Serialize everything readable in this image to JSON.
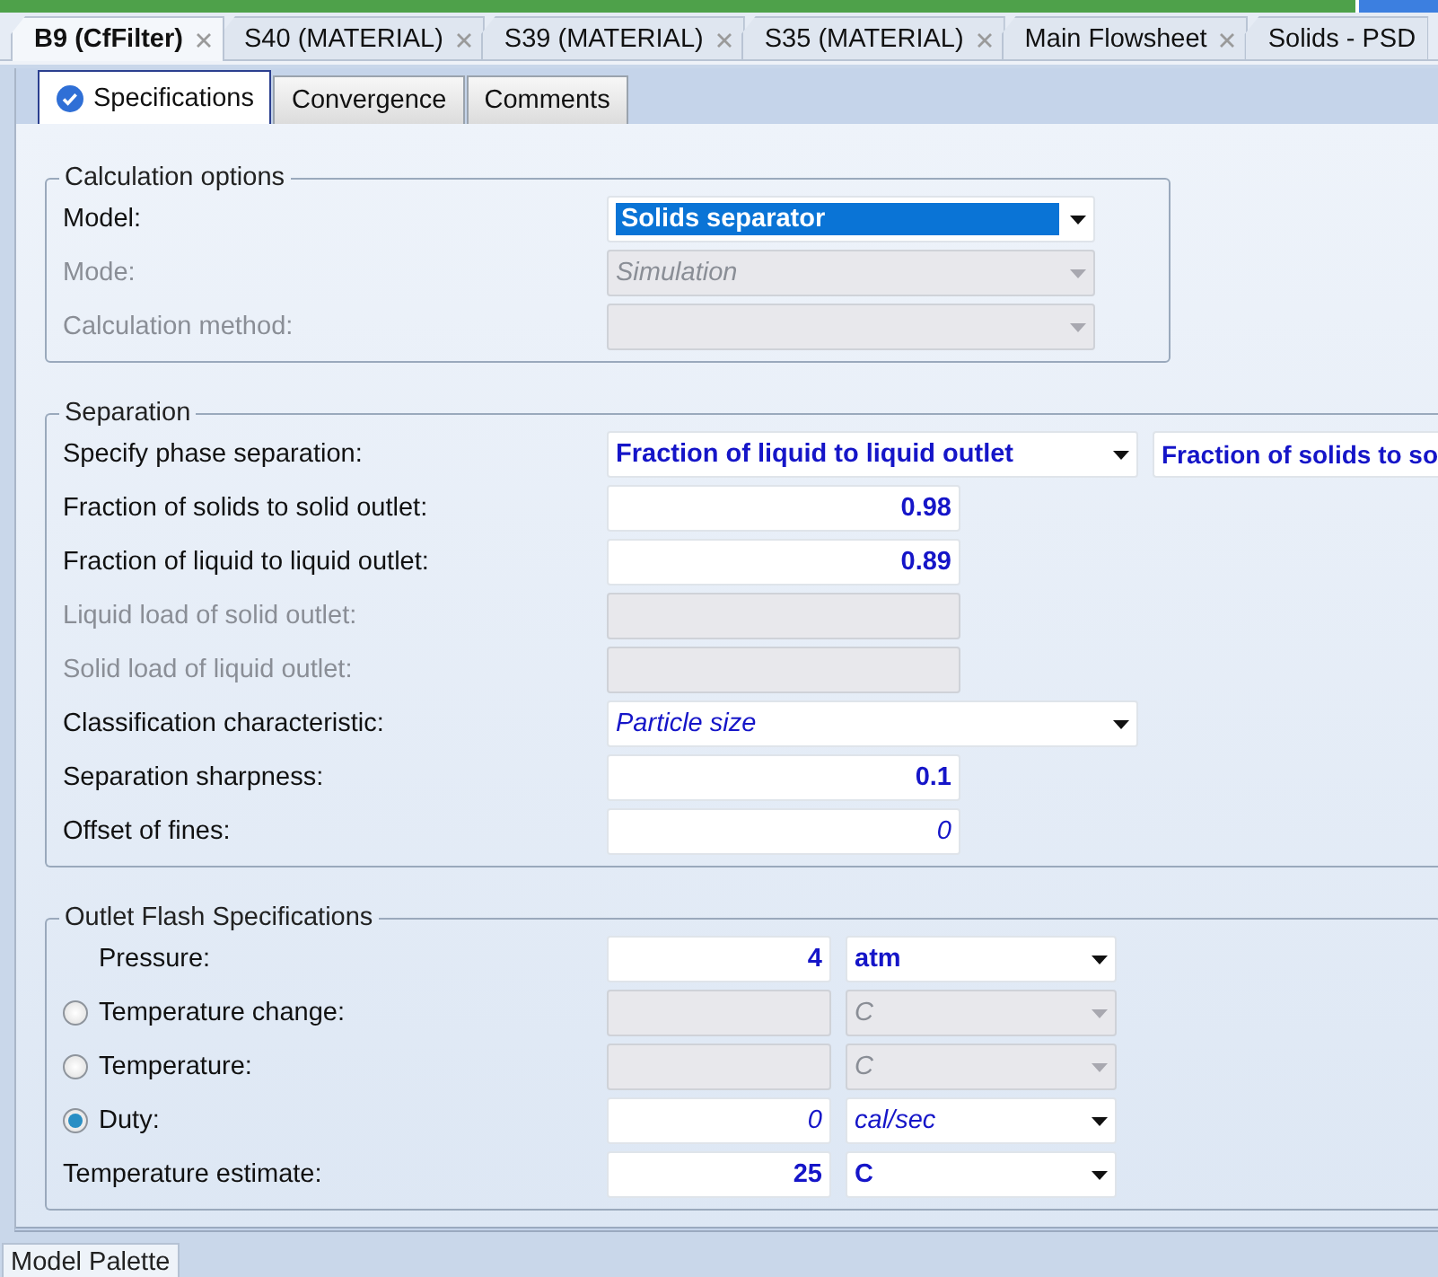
{
  "document_tabs": [
    {
      "label": "B9 (CfFilter)",
      "selected": true,
      "closable": true
    },
    {
      "label": "S40 (MATERIAL)",
      "selected": false,
      "closable": true
    },
    {
      "label": "S39 (MATERIAL)",
      "selected": false,
      "closable": true
    },
    {
      "label": "S35 (MATERIAL)",
      "selected": false,
      "closable": true
    },
    {
      "label": "Main Flowsheet",
      "selected": false,
      "closable": true
    },
    {
      "label": "Solids - PSD",
      "selected": false,
      "closable": false
    }
  ],
  "form_tabs": [
    {
      "label": "Specifications",
      "selected": true,
      "complete": true
    },
    {
      "label": "Convergence",
      "selected": false,
      "complete": false
    },
    {
      "label": "Comments",
      "selected": false,
      "complete": false
    }
  ],
  "sections": [
    {
      "title": "Calculation options",
      "rows": [
        {
          "kind": "plain",
          "label": "Model:",
          "disabled": false,
          "controls": [
            {
              "kind": "select",
              "value": "Solids separator",
              "bold": true,
              "italic": false,
              "disabled": false,
              "highlighted": true
            }
          ]
        },
        {
          "kind": "plain",
          "label": "Mode:",
          "disabled": true,
          "controls": [
            {
              "kind": "select",
              "value": "Simulation",
              "bold": false,
              "italic": true,
              "disabled": true,
              "highlighted": false
            }
          ]
        },
        {
          "kind": "plain",
          "label": "Calculation method:",
          "disabled": true,
          "controls": [
            {
              "kind": "select",
              "disabled": true,
              "highlighted": false
            }
          ]
        }
      ]
    },
    {
      "title": "Separation",
      "rows": [
        {
          "kind": "plain",
          "label": "Specify phase separation:",
          "disabled": false,
          "controls": [
            {
              "kind": "select",
              "value": "Fraction of liquid to liquid outlet",
              "bold": true,
              "italic": false,
              "disabled": false,
              "highlighted": false
            },
            {
              "kind": "select",
              "value": "Fraction of solids to so",
              "bold": true,
              "italic": false,
              "disabled": false,
              "highlighted": false
            }
          ]
        },
        {
          "kind": "plain",
          "label": "Fraction of solids to solid outlet:",
          "disabled": false,
          "controls": [
            {
              "kind": "input",
              "value": "0.98",
              "bold": true,
              "italic": false,
              "disabled": false
            }
          ]
        },
        {
          "kind": "plain",
          "label": "Fraction of liquid to liquid outlet:",
          "disabled": false,
          "controls": [
            {
              "kind": "input",
              "value": "0.89",
              "bold": true,
              "italic": false,
              "disabled": false
            }
          ]
        },
        {
          "kind": "plain",
          "label": "Liquid load of solid outlet:",
          "disabled": true,
          "controls": [
            {
              "kind": "input",
              "disabled": true
            }
          ]
        },
        {
          "kind": "plain",
          "label": "Solid load of liquid outlet:",
          "disabled": true,
          "controls": [
            {
              "kind": "input",
              "disabled": true
            }
          ]
        },
        {
          "kind": "plain",
          "label": "Classification characteristic:",
          "disabled": false,
          "controls": [
            {
              "kind": "select",
              "value": "Particle size",
              "bold": false,
              "italic": true,
              "disabled": false,
              "highlighted": false
            }
          ]
        },
        {
          "kind": "plain",
          "label": "Separation sharpness:",
          "disabled": false,
          "controls": [
            {
              "kind": "input",
              "value": "0.1",
              "bold": true,
              "italic": false,
              "disabled": false
            }
          ]
        },
        {
          "kind": "plain",
          "label": "Offset of fines:",
          "disabled": false,
          "controls": [
            {
              "kind": "input",
              "value": "0",
              "bold": false,
              "italic": true,
              "disabled": false
            }
          ]
        }
      ]
    },
    {
      "title": "Outlet Flash Specifications",
      "rows": [
        {
          "kind": "indented",
          "label": "Pressure:",
          "disabled": false,
          "controls": [
            {
              "kind": "input",
              "value": "4",
              "bold": true,
              "italic": false,
              "disabled": false
            },
            {
              "kind": "select",
              "value": "atm",
              "bold": true,
              "italic": false,
              "disabled": false,
              "highlighted": false
            }
          ]
        },
        {
          "kind": "radio",
          "label": "Temperature change:",
          "selected": false,
          "disabled": false,
          "controls": [
            {
              "kind": "input",
              "disabled": true
            },
            {
              "kind": "select",
              "value": "C",
              "bold": false,
              "italic": true,
              "disabled": true,
              "highlighted": false
            }
          ]
        },
        {
          "kind": "radio",
          "label": "Temperature:",
          "selected": false,
          "disabled": false,
          "controls": [
            {
              "kind": "input",
              "disabled": true
            },
            {
              "kind": "select",
              "value": "C",
              "bold": false,
              "italic": true,
              "disabled": true,
              "highlighted": false
            }
          ]
        },
        {
          "kind": "radio",
          "label": "Duty:",
          "selected": true,
          "disabled": false,
          "controls": [
            {
              "kind": "input",
              "value": "0",
              "bold": false,
              "italic": true,
              "disabled": false
            },
            {
              "kind": "select",
              "value": "cal/sec",
              "bold": false,
              "italic": true,
              "disabled": false,
              "highlighted": false
            }
          ]
        },
        {
          "kind": "plain",
          "label": "Temperature estimate:",
          "disabled": false,
          "controls": [
            {
              "kind": "input",
              "value": "25",
              "bold": true,
              "italic": false,
              "disabled": false
            },
            {
              "kind": "select",
              "value": "C",
              "bold": true,
              "italic": false,
              "disabled": false,
              "highlighted": false
            }
          ]
        }
      ]
    }
  ],
  "bottom_tabs": [
    {
      "label": "Model Palette",
      "selected": true
    }
  ]
}
